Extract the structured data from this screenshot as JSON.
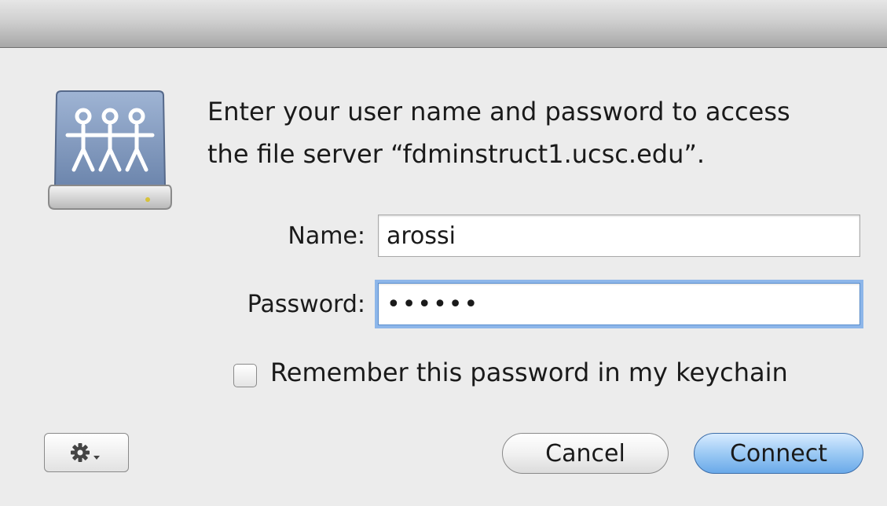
{
  "dialog": {
    "message_line1": "Enter your user name and password to access",
    "message_line2": "the file server “fdminstruct1.ucsc.edu”.",
    "server_icon": "network-file-server-icon"
  },
  "form": {
    "name_label": "Name:",
    "name_value": "arossi",
    "password_label": "Password:",
    "password_value": "••••••",
    "remember_label": "Remember this password in my keychain",
    "remember_checked": false
  },
  "buttons": {
    "cancel_label": "Cancel",
    "connect_label": "Connect",
    "gear_icon": "gear-icon"
  },
  "colors": {
    "accent_focus": "#8db6e9",
    "default_button": "#6aa9e9",
    "window_background": "#ececec"
  }
}
